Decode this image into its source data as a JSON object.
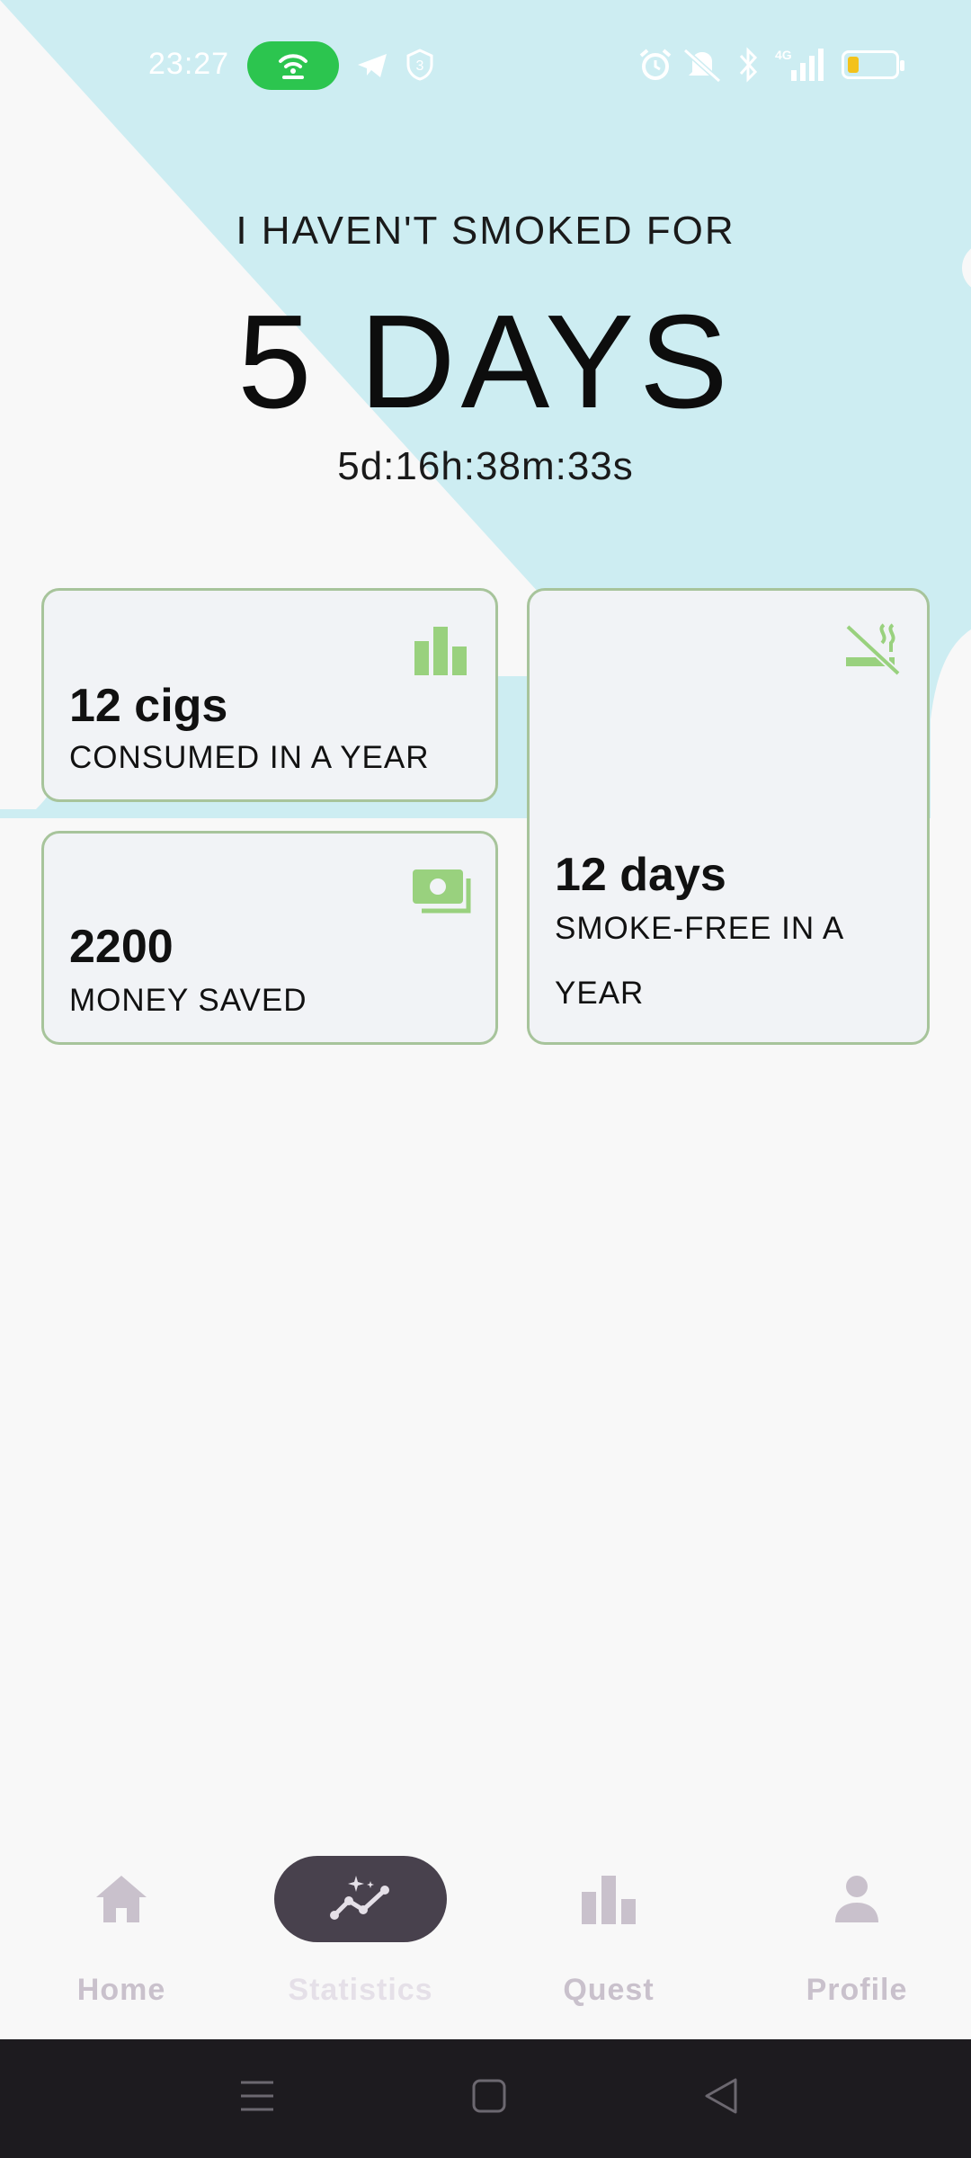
{
  "status_bar": {
    "time": "23:27",
    "icons": [
      "hotspot-icon",
      "telegram-icon",
      "shield-icon",
      "alarm-icon",
      "mute-icon",
      "bluetooth-icon",
      "signal-4g-icon",
      "battery-icon"
    ],
    "signal_label": "4G",
    "shield_number": "3"
  },
  "hero": {
    "label": "I HAVEN'T SMOKED FOR",
    "days": "5 DAYS",
    "timer": "5d:16h:38m:33s",
    "bg_color": "#cdedf2"
  },
  "cards": {
    "consumed": {
      "value": "12 cigs",
      "caption": "CONSUMED IN A YEAR",
      "icon": "bar-chart-icon"
    },
    "smoke_free": {
      "value": "12 days",
      "caption": "SMOKE-FREE IN A YEAR",
      "icon": "no-smoking-icon"
    },
    "money": {
      "value": "2200",
      "caption": "MONEY SAVED",
      "icon": "money-icon"
    },
    "accent_color": "#99d17e",
    "border_color": "#a7c49b"
  },
  "bottom_nav": {
    "items": [
      {
        "label": "Home",
        "icon": "home-icon"
      },
      {
        "label": "Statistics",
        "icon": "statistics-icon",
        "active": true
      },
      {
        "label": "Quest",
        "icon": "quest-bar-icon"
      },
      {
        "label": "Profile",
        "icon": "profile-icon"
      }
    ]
  },
  "system_nav": {
    "buttons": [
      "menu-icon",
      "home-square-icon",
      "back-triangle-icon"
    ]
  }
}
